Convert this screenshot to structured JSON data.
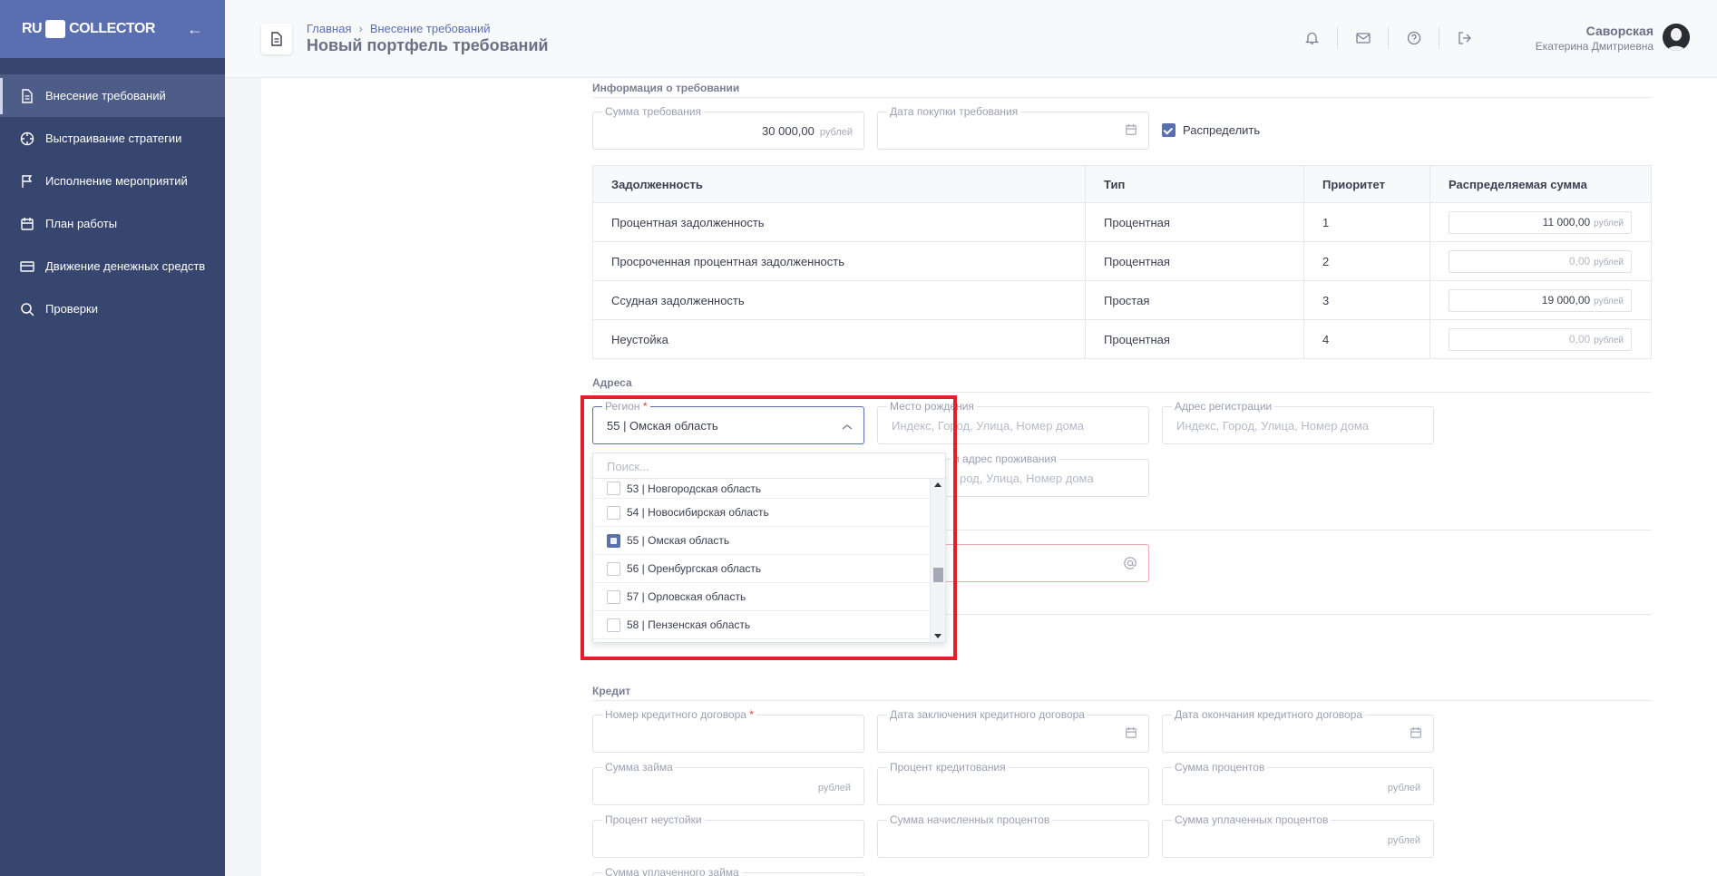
{
  "app": {
    "logo_left": "RU",
    "logo_right": "COLLECTOR"
  },
  "sidebar": {
    "items": [
      {
        "label": "Внесение требований",
        "icon": "document-icon",
        "active": true
      },
      {
        "label": "Выстраивание стратегии",
        "icon": "crosshair-icon",
        "active": false
      },
      {
        "label": "Исполнение мероприятий",
        "icon": "flag-icon",
        "active": false
      },
      {
        "label": "План работы",
        "icon": "calendar-icon",
        "active": false
      },
      {
        "label": "Движение денежных средств",
        "icon": "credit-card-icon",
        "active": false
      },
      {
        "label": "Проверки",
        "icon": "search-icon",
        "active": false
      }
    ]
  },
  "header": {
    "breadcrumb": [
      "Главная",
      "Внесение требований"
    ],
    "title": "Новый портфель требований",
    "user_name": "Саворская",
    "user_sub": "Екатерина Дмитриевна"
  },
  "claim_info": {
    "section_title": "Информация о требовании",
    "amount_label": "Сумма требования",
    "amount_value": "30 000,00",
    "amount_unit": "рублей",
    "purchase_date_label": "Дата покупки требования",
    "distribute_label": "Распределить",
    "distribute_checked": true
  },
  "debt_table": {
    "columns": [
      "Задолженность",
      "Тип",
      "Приоритет",
      "Распределяемая сумма"
    ],
    "rows": [
      {
        "name": "Процентная задолженность",
        "type": "Процентная",
        "priority": "1",
        "amount": "11 000,00"
      },
      {
        "name": "Просроченная процентная задолженность",
        "type": "Процентная",
        "priority": "2",
        "amount": "0,00"
      },
      {
        "name": "Ссудная задолженность",
        "type": "Простая",
        "priority": "3",
        "amount": "19 000,00"
      },
      {
        "name": "Неустойка",
        "type": "Процентная",
        "priority": "4",
        "amount": "0,00"
      }
    ],
    "unit": "рублей"
  },
  "address": {
    "section_title": "Адреса",
    "region_label": "Регион",
    "region_value": "55 | Омская область",
    "birthplace_label": "Место рождения",
    "birthplace_placeholder": "Индекс, Город, Улица, Номер дома",
    "registration_label": "Адрес регистрации",
    "registration_placeholder": "Индекс, Город, Улица, Номер дома",
    "actual_label_partial": "и адрес проживания",
    "actual_placeholder_partial": "род, Улица, Номер дома"
  },
  "region_dropdown": {
    "search_placeholder": "Поиск...",
    "options": [
      {
        "label": "53 | Новгородская область",
        "checked": false
      },
      {
        "label": "54 | Новосибирская область",
        "checked": false
      },
      {
        "label": "55 | Омская область",
        "checked": true
      },
      {
        "label": "56 | Оренбургская область",
        "checked": false
      },
      {
        "label": "57 | Орловская область",
        "checked": false
      },
      {
        "label": "58 | Пензенская область",
        "checked": false
      }
    ]
  },
  "credit": {
    "section_title": "Кредит",
    "contract_number_label": "Номер кредитного договора",
    "contract_date_label": "Дата заключения кредитного договора",
    "contract_end_label": "Дата окончания кредитного договора",
    "loan_amount_label": "Сумма займа",
    "interest_rate_label": "Процент кредитования",
    "interest_sum_label": "Сумма процентов",
    "penalty_label": "Процент неустойки",
    "accrued_label": "Сумма начисленных процентов",
    "paid_interest_label": "Сумма уплаченных процентов",
    "paid_loan_label": "Сумма уплаченного займа",
    "unit": "рублей"
  },
  "colors": {
    "sidebar": "#37466e",
    "sidebar_head": "#5a6fb0",
    "accent": "#5a6fb0",
    "highlight": "#e0202a"
  }
}
